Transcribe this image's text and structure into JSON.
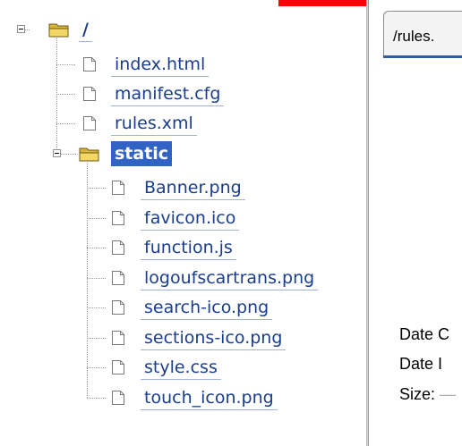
{
  "tab": {
    "label": "/rules."
  },
  "details": {
    "date_created_label": "Date C",
    "date_modified_label": "Date I",
    "size_label": "Size:",
    "size_value": "—"
  },
  "tree": {
    "root": {
      "label": "/",
      "expanded": true
    },
    "root_files": [
      "index.html",
      "manifest.cfg",
      "rules.xml"
    ],
    "static_folder": {
      "label": "static",
      "expanded": true,
      "selected": true
    },
    "static_files": [
      "Banner.png",
      "favicon.ico",
      "function.js",
      "logoufscartrans.png",
      "search-ico.png",
      "sections-ico.png",
      "style.css",
      "touch_icon.png"
    ]
  },
  "colors": {
    "link": "#1a3d8f",
    "selected_bg": "#3163c5",
    "folder": "#e9c94b",
    "header_mark": "#ff0000"
  }
}
